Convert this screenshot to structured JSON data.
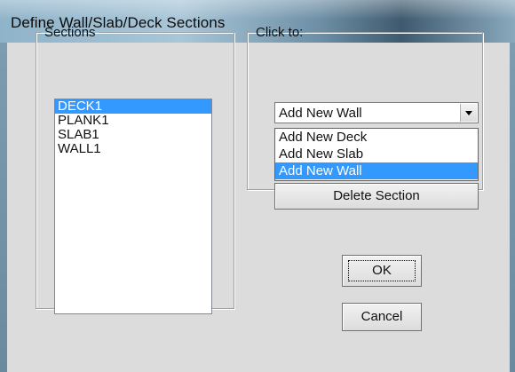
{
  "window": {
    "title": "Define Wall/Slab/Deck Sections"
  },
  "sections": {
    "legend": "Sections",
    "items": [
      {
        "label": "DECK1",
        "selected": true
      },
      {
        "label": "PLANK1",
        "selected": false
      },
      {
        "label": "SLAB1",
        "selected": false
      },
      {
        "label": "WALL1",
        "selected": false
      }
    ]
  },
  "click_to": {
    "legend": "Click to:",
    "combo_value": "Add New Wall",
    "options": [
      {
        "label": "Add New Deck",
        "selected": false
      },
      {
        "label": "Add New Slab",
        "selected": false
      },
      {
        "label": "Add New Wall",
        "selected": true
      }
    ],
    "delete_label": "Delete Section"
  },
  "buttons": {
    "ok": "OK",
    "cancel": "Cancel"
  },
  "colors": {
    "selection": "#3399ff",
    "dialog_bg": "#dcdcdc"
  }
}
